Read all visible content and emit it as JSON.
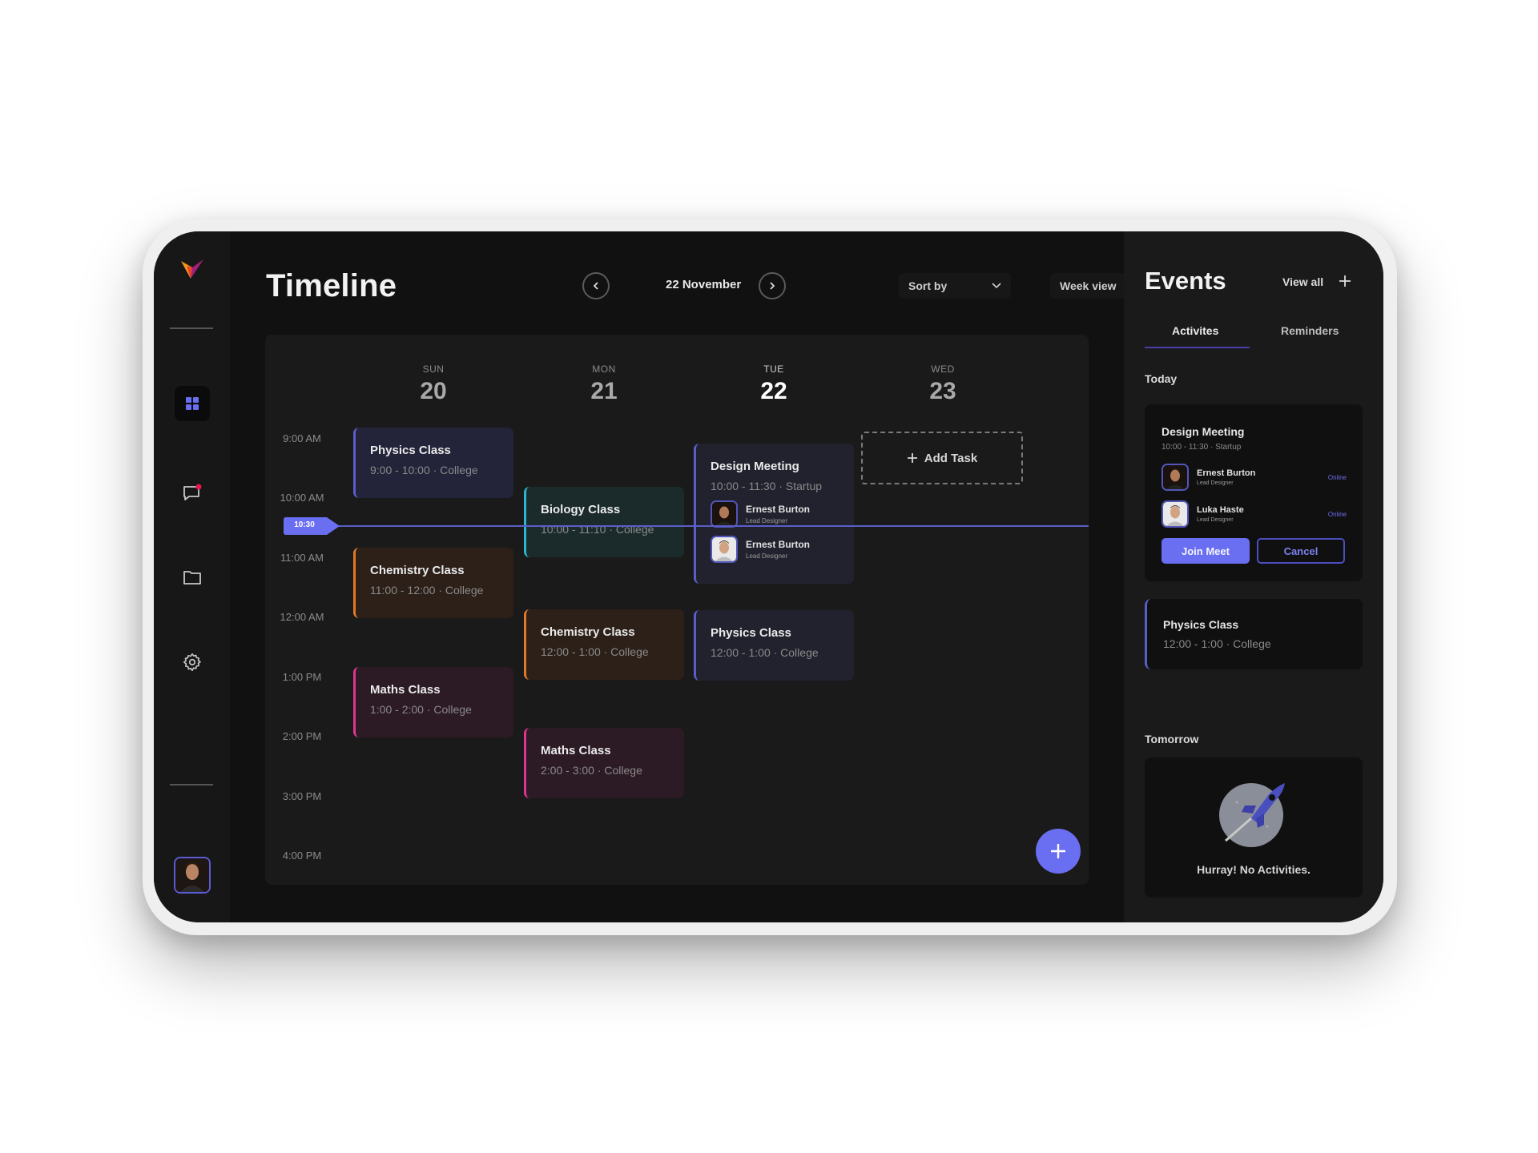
{
  "app": {
    "logo": "v-logo-icon"
  },
  "sidebar": {
    "items": [
      {
        "name": "dashboard",
        "icon": "grid-icon",
        "active": true
      },
      {
        "name": "messages",
        "icon": "chat-icon",
        "has_notification": true
      },
      {
        "name": "files",
        "icon": "folder-icon"
      },
      {
        "name": "settings",
        "icon": "gear-icon"
      }
    ],
    "user_avatar": "user-avatar"
  },
  "header": {
    "title": "Timeline",
    "date_label": "22 November",
    "prev_icon": "chevron-left-icon",
    "next_icon": "chevron-right-icon",
    "sort_label": "Sort by",
    "view_label": "Week view"
  },
  "calendar": {
    "days": [
      {
        "name": "SUN",
        "num": "20",
        "today": false
      },
      {
        "name": "MON",
        "num": "21",
        "today": false
      },
      {
        "name": "TUE",
        "num": "22",
        "today": true
      },
      {
        "name": "WED",
        "num": "23",
        "today": false
      }
    ],
    "times": [
      "9:00 AM",
      "10:00 AM",
      "11:00 AM",
      "12:00 AM",
      "1:00 PM",
      "2:00 PM",
      "3:00 PM",
      "4:00 PM"
    ],
    "current_time": "10:30",
    "add_task_label": "Add Task",
    "events": [
      {
        "day": "SUN",
        "title": "Physics Class",
        "sub": "9:00 - 10:00 · College",
        "color": "#5b5ec8",
        "bg": "#23233a"
      },
      {
        "day": "SUN",
        "title": "Chemistry Class",
        "sub": "11:00 - 12:00 · College",
        "color": "#e07a2a",
        "bg": "#2c2019"
      },
      {
        "day": "SUN",
        "title": "Maths Class",
        "sub": "1:00 - 2:00 · College",
        "color": "#e0358f",
        "bg": "#2c1a24"
      },
      {
        "day": "MON",
        "title": "Biology Class",
        "sub": "10:00 - 11:10 · College",
        "color": "#27b8cf",
        "bg": "#1b2b2c"
      },
      {
        "day": "MON",
        "title": "Chemistry Class",
        "sub": "12:00 - 1:00 · College",
        "color": "#e07a2a",
        "bg": "#2c2019"
      },
      {
        "day": "MON",
        "title": "Maths Class",
        "sub": "2:00 - 3:00 · College",
        "color": "#e0358f",
        "bg": "#2c1a24"
      },
      {
        "day": "TUE",
        "title": "Design Meeting",
        "sub": "10:00 - 11:30 · Startup",
        "color": "#5b5ec8",
        "bg": "#22222f",
        "attendees": [
          {
            "name": "Ernest Burton",
            "role": "Lead Designer"
          },
          {
            "name": "Ernest Burton",
            "role": "Lead Designer"
          }
        ]
      },
      {
        "day": "TUE",
        "title": "Physics Class",
        "sub": "12:00 - 1:00 · College",
        "color": "#5b5ec8",
        "bg": "#22222f"
      }
    ]
  },
  "events_panel": {
    "title": "Events",
    "view_all": "View all",
    "tabs": [
      {
        "label": "Activites",
        "active": true
      },
      {
        "label": "Reminders",
        "active": false
      }
    ],
    "today_label": "Today",
    "today_meeting": {
      "title": "Design Meeting",
      "sub": "10:00 - 11:30 · Startup",
      "attendees": [
        {
          "name": "Ernest Burton",
          "role": "Lead Designer",
          "status": "Online"
        },
        {
          "name": "Luka Haste",
          "role": "Lead Designer",
          "status": "Online"
        }
      ],
      "join_label": "Join Meet",
      "cancel_label": "Cancel"
    },
    "today_class": {
      "title": "Physics Class",
      "sub": "12:00 - 1:00 · College"
    },
    "tomorrow_label": "Tomorrow",
    "tomorrow_empty": "Hurray! No Activities.",
    "colors": {
      "accent": "#6a6ef0"
    }
  }
}
